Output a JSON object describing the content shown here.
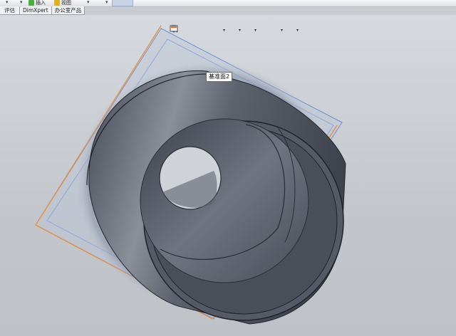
{
  "toolbar": {
    "items": [
      {
        "label": "插入",
        "icon": "insert-icon"
      },
      {
        "label": "视图",
        "icon": "view-icon"
      }
    ]
  },
  "tabs": [
    {
      "label": "评估"
    },
    {
      "label": "DimXpert"
    },
    {
      "label": "办公室产品"
    }
  ],
  "heads_up_toolbar": [
    {
      "icon": "zoom-to-fit-icon"
    },
    {
      "icon": "zoom-to-area-icon"
    },
    {
      "icon": "previous-view-icon"
    },
    {
      "icon": "section-view-icon"
    },
    {
      "icon": "view-orientation-icon",
      "dropdown": true
    },
    {
      "icon": "display-style-icon",
      "dropdown": true
    },
    {
      "icon": "hide-show-items-icon",
      "dropdown": true
    },
    {
      "icon": "edit-appearance-icon"
    },
    {
      "icon": "apply-scene-icon",
      "dropdown": true
    },
    {
      "icon": "view-settings-icon",
      "dropdown": true
    }
  ],
  "tooltip": {
    "text": "基准面2"
  },
  "colors": {
    "plane_highlight": "#f08a2a",
    "plane_edge": "#6a8fd8",
    "part_body": "#5a5f6b",
    "background": "#c8ccd0"
  }
}
